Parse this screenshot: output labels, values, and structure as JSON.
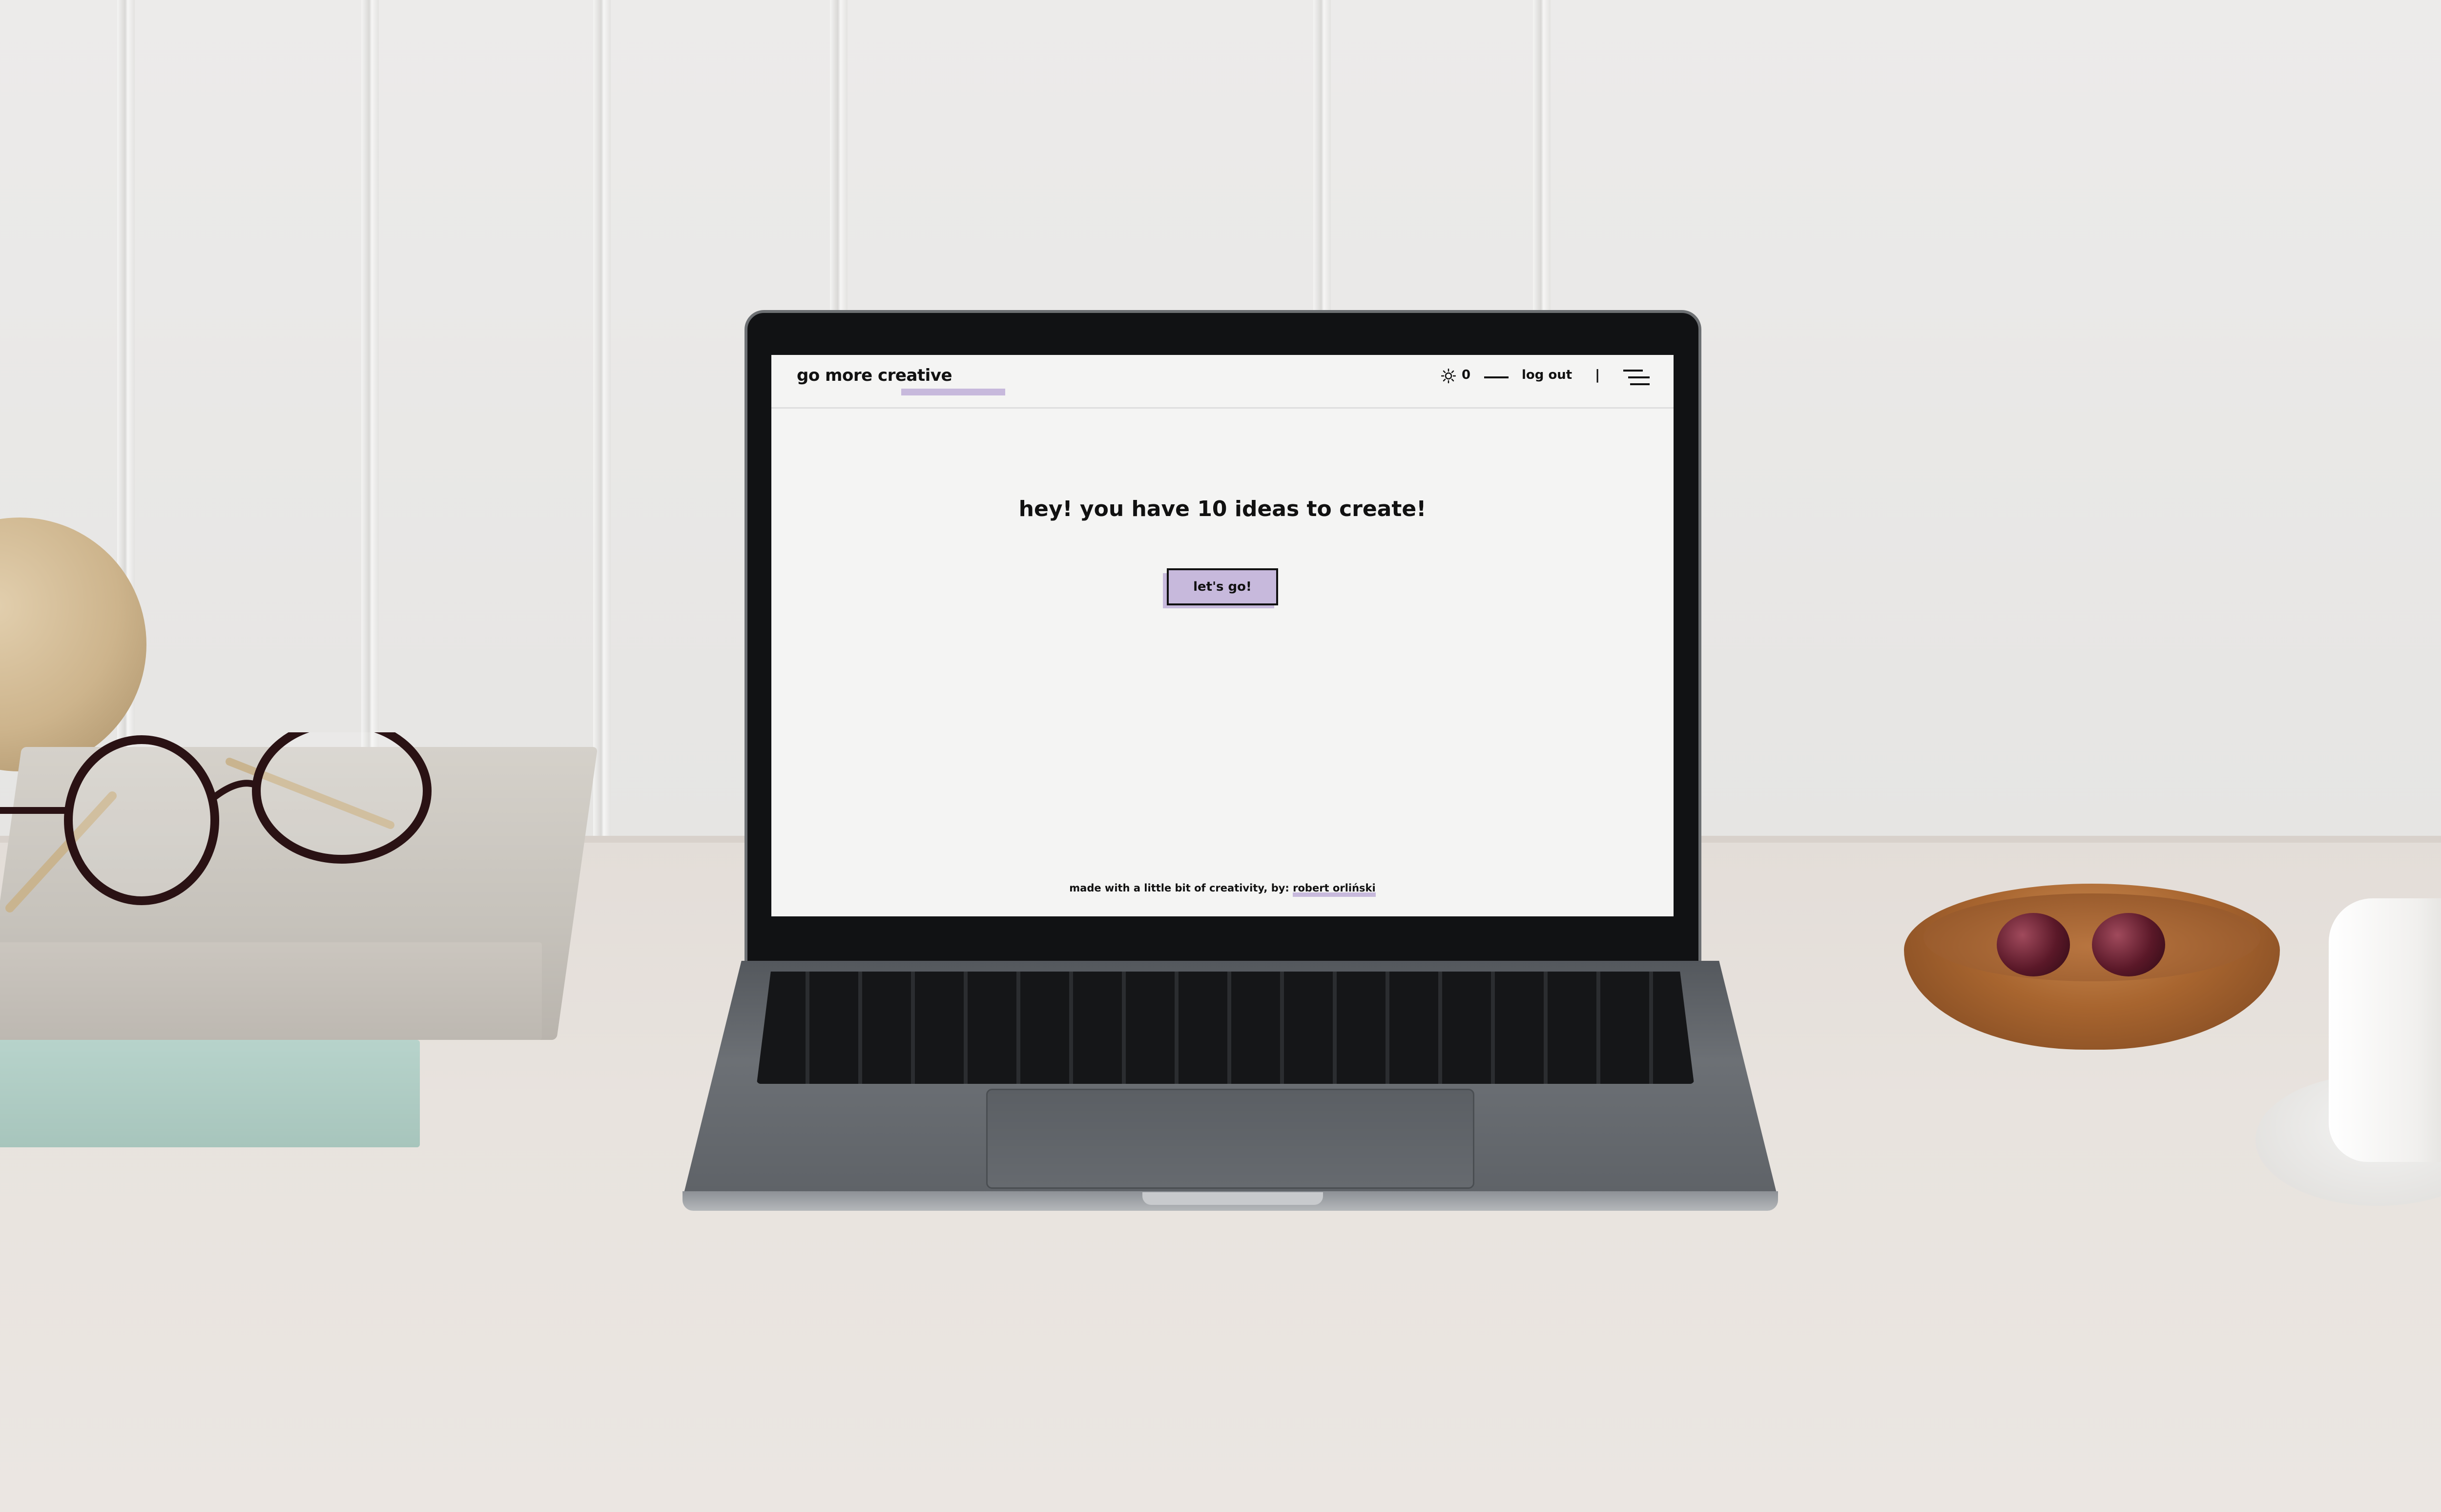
{
  "app": {
    "logo": "go more creative",
    "accent_color": "#c7b9dc"
  },
  "header": {
    "theme_icon": "sun-icon",
    "counter": "0",
    "logout_label": "log out",
    "separator": "|",
    "menu_icon": "hamburger-menu-icon"
  },
  "main": {
    "headline": "hey! you have 10 ideas to create!",
    "cta_label": "let's go!"
  },
  "footer": {
    "text": "made with a little bit of creativity, by: ",
    "author": "robert orliński"
  }
}
